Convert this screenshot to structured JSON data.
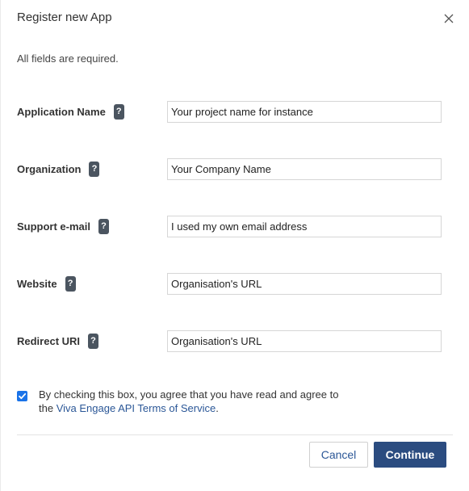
{
  "dialog": {
    "title": "Register new App",
    "subtitle": "All fields are required."
  },
  "fields": [
    {
      "label": "Application Name",
      "value": "Your project name for instance"
    },
    {
      "label": "Organization",
      "value": "Your Company Name"
    },
    {
      "label": "Support e-mail",
      "value": "I used my own email address"
    },
    {
      "label": "Website",
      "value": "Organisation's URL"
    },
    {
      "label": "Redirect URI",
      "value": "Organisation's URL"
    }
  ],
  "help_glyph": "?",
  "agreement": {
    "checked": true,
    "text_before": "By checking this box, you agree that you have read and agree to the ",
    "link_text": "Viva Engage API Terms of Service",
    "text_after": "."
  },
  "buttons": {
    "cancel": "Cancel",
    "continue": "Continue"
  },
  "icons": {
    "close": "close-icon",
    "help": "help-icon",
    "check": "checkmark-icon"
  },
  "colors": {
    "primary": "#2b4c80",
    "link": "#2b5797",
    "checkbox": "#1a73e8",
    "help_badge": "#4b5560"
  }
}
